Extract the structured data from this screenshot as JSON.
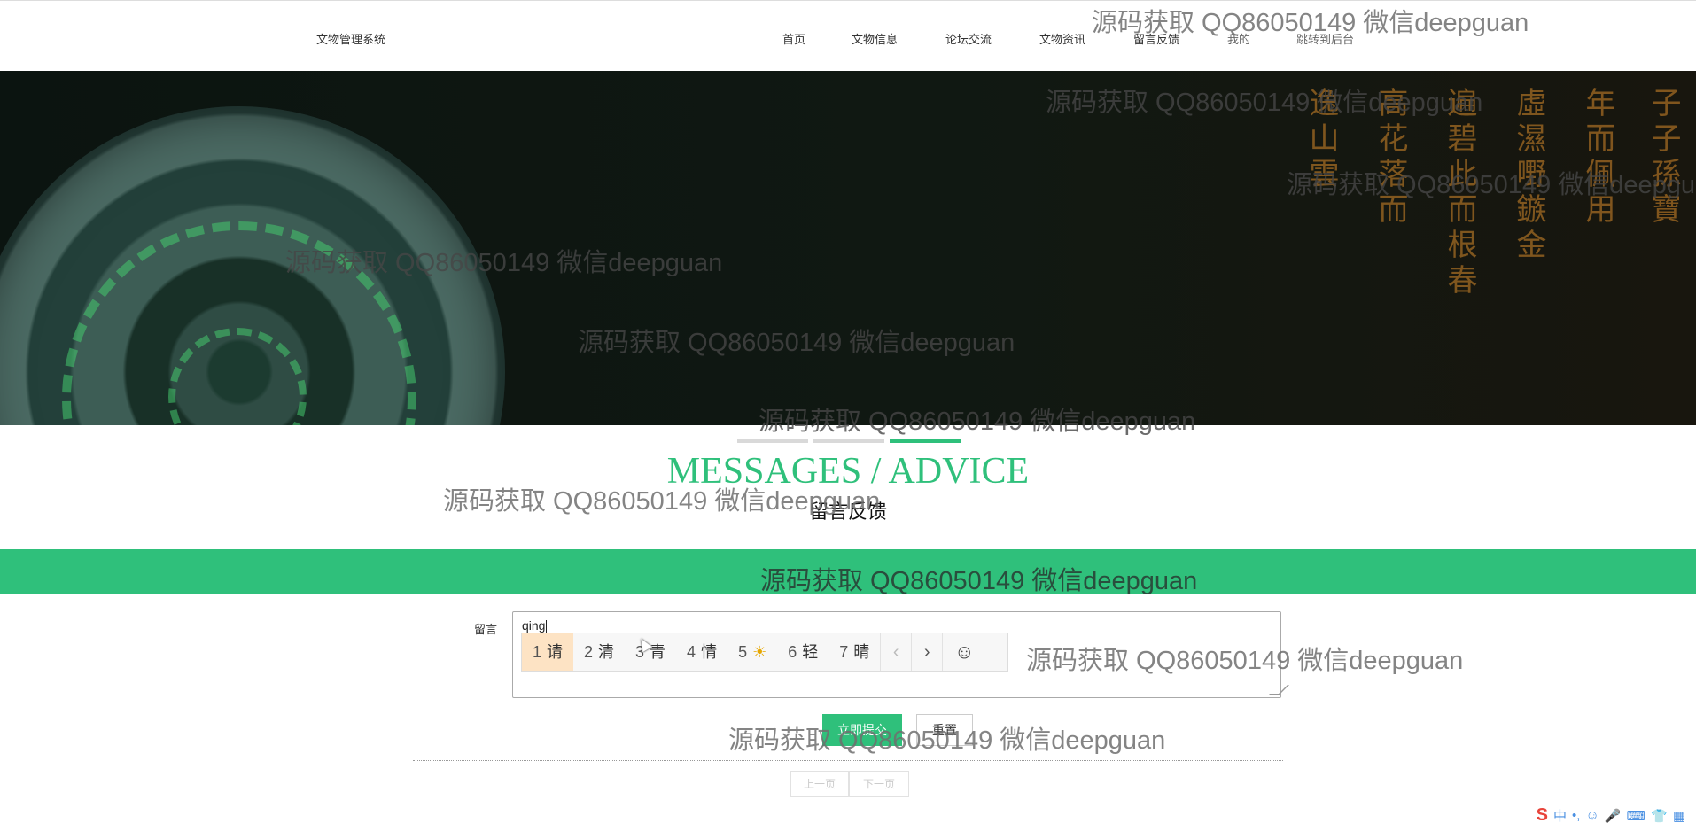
{
  "site": {
    "title": "文物管理系统"
  },
  "nav": [
    {
      "label": "首页"
    },
    {
      "label": "文物信息"
    },
    {
      "label": "论坛交流"
    },
    {
      "label": "文物资讯"
    },
    {
      "label": "留言反馈"
    },
    {
      "label": "我的"
    },
    {
      "label": "跳转到后台"
    }
  ],
  "banner": {
    "calligraphy_cols": [
      "逸山雲",
      "高花落而",
      "遍碧此而根春",
      "虛濕嘢鏃金",
      "年而佩用",
      "子子孫寶"
    ]
  },
  "section": {
    "title_en": "MESSAGES / ADVICE",
    "title_cn": "留言反馈"
  },
  "form": {
    "label": "留言",
    "input_value": "qing",
    "submit_label": "立即提交",
    "reset_label": "重置"
  },
  "ime": {
    "candidates": [
      {
        "num": "1",
        "text": "请"
      },
      {
        "num": "2",
        "text": "清"
      },
      {
        "num": "3",
        "text": "青"
      },
      {
        "num": "4",
        "text": "情"
      },
      {
        "num": "5",
        "text": "☀"
      },
      {
        "num": "6",
        "text": "轻"
      },
      {
        "num": "7",
        "text": "晴"
      }
    ],
    "prev": "‹",
    "next": "›",
    "emoji": "☺",
    "status": [
      "S",
      "中",
      "•,",
      "☺",
      "🎤",
      "⌨",
      "👕",
      "▦"
    ]
  },
  "pager": {
    "prev": "上一页",
    "next": "下一页"
  },
  "watermark": "源码获取 QQ86050149 微信deepguan",
  "colors": {
    "accent": "#2fc07b"
  }
}
